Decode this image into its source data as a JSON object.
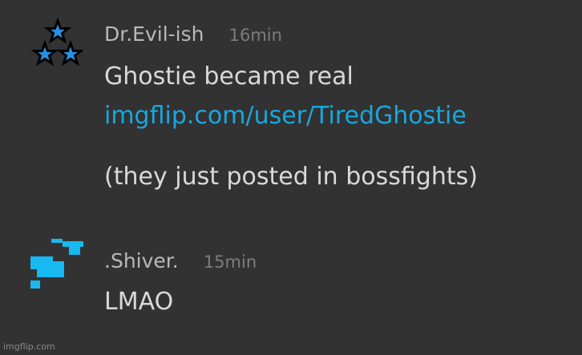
{
  "messages": [
    {
      "username": "Dr.Evil-ish",
      "time": "16min",
      "avatar_icon": "three-stars-icon",
      "lines": [
        {
          "text": "Ghostie became real"
        },
        {
          "text": "imgflip.com/user/TiredGhostie",
          "link": true
        },
        {
          "text": "(they just posted in bossfights)"
        }
      ]
    },
    {
      "username": ".Shiver.",
      "time": "15min",
      "avatar_icon": "pixel-creature-icon",
      "lines": [
        {
          "text": "LMAO"
        }
      ]
    }
  ],
  "colors": {
    "background": "#323232",
    "text": "#d9d9d9",
    "username": "#b9b9b9",
    "time": "#7d7d7d",
    "link": "#1aa7dc",
    "star_fill": "#2b8fe0",
    "pixel_avatar": "#18b8f0"
  },
  "watermark": "imgflip.com"
}
